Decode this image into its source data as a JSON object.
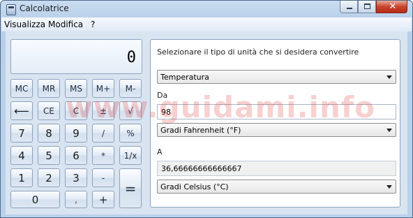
{
  "window": {
    "title": "Calcolatrice",
    "watermark": "www.guidami.info"
  },
  "menu": {
    "view": "Visualizza",
    "edit": "Modifica",
    "help": "?"
  },
  "calculator": {
    "display": "0",
    "buttons": {
      "mc": "MC",
      "mr": "MR",
      "ms": "MS",
      "mplus": "M+",
      "mminus": "M-",
      "backspace": "⟵",
      "ce": "CE",
      "c": "C",
      "plusminus": "±",
      "sqrt": "√",
      "n7": "7",
      "n8": "8",
      "n9": "9",
      "divide": "/",
      "percent": "%",
      "n4": "4",
      "n5": "5",
      "n6": "6",
      "multiply": "*",
      "reciprocal": "1/x",
      "n1": "1",
      "n2": "2",
      "n3": "3",
      "minus": "-",
      "equals": "=",
      "n0": "0",
      "decimal": ",",
      "plus": "+"
    }
  },
  "converter": {
    "instruction": "Selezionare il tipo di unità che si desidera convertire",
    "unit_type": "Temperatura",
    "from_label": "Da",
    "from_value": "98",
    "from_unit": "Gradi Fahrenheit (°F)",
    "to_label": "A",
    "to_value": "36,66666666666667",
    "to_unit": "Gradi Celsius (°C)"
  }
}
